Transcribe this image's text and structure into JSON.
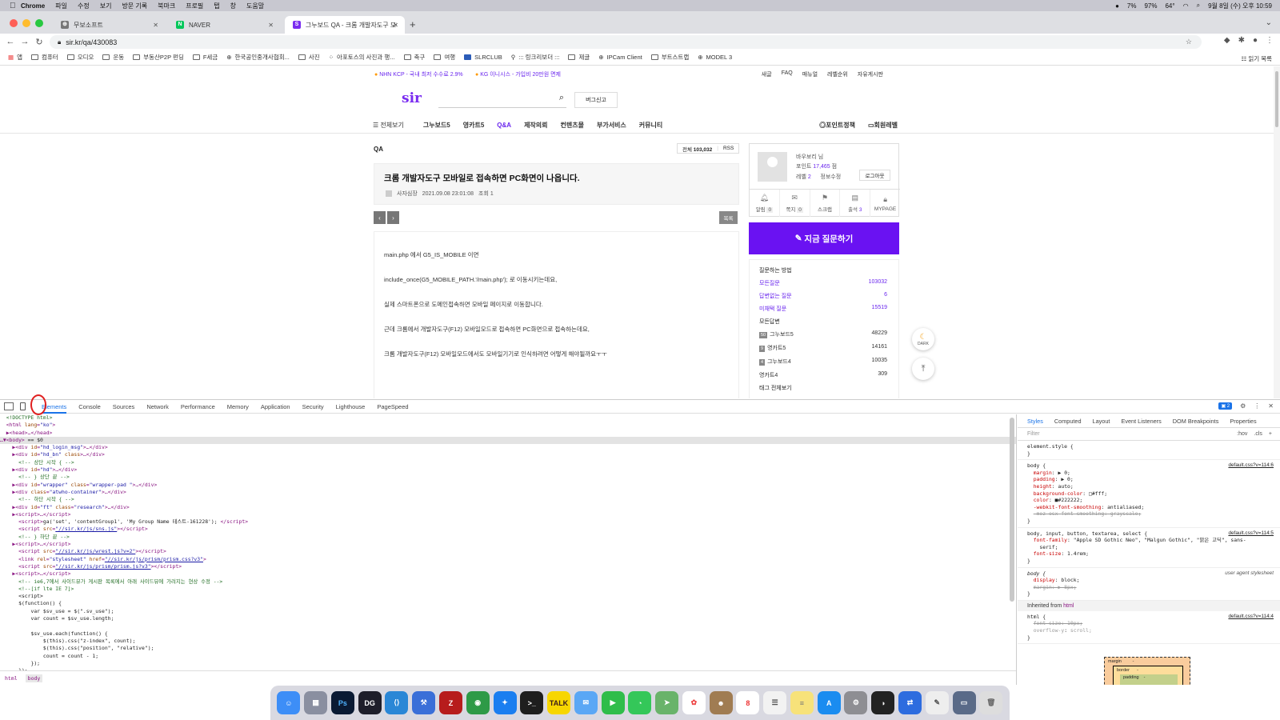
{
  "menubar": {
    "app": "Chrome",
    "items": [
      "파일",
      "수정",
      "보기",
      "방문 기록",
      "북마크",
      "프로필",
      "탭",
      "창",
      "도움말"
    ],
    "status": [
      "7%",
      "97%",
      "64°"
    ],
    "clock": "9월 8일 (수) 오후 10:59"
  },
  "tabs": [
    {
      "title": "무보소프트",
      "icon": "globe-icon",
      "color": "#555555"
    },
    {
      "title": "NAVER",
      "icon": "naver-icon",
      "color": "#03c75a"
    },
    {
      "title": "그누보드 QA - 크롬 개발자도구 모바",
      "icon": "sir-icon",
      "color": "#7a2cf0"
    }
  ],
  "address": {
    "url": "sir.kr/qa/430083"
  },
  "bookmarks": [
    "앱",
    "컴퓨터",
    "오디오",
    "운동",
    "부동산P2P 펀딩",
    "F세금",
    "한국공인중개사협회...",
    "사진",
    "아포토스의 사진과 행...",
    "축구",
    "여행",
    "SLRCLUB",
    "::: 링크리보더 :::",
    "제글",
    "IPCam Client",
    "부트스트랩",
    "MODEL 3"
  ],
  "bookmarks_right": "읽기 목록",
  "site": {
    "notice1": "NHN KCP - 국내 최저 수수료 2.9%",
    "notice2": "KG 이니시스 - 가입비 20만원 면제",
    "toplinks": [
      "새글",
      "FAQ",
      "매뉴얼",
      "레벨순위",
      "자유게시판"
    ],
    "logo": "sir",
    "bug_button": "버그신고",
    "nav_all": "전체보기",
    "nav": [
      "그누보드5",
      "영카트5",
      "Q&A",
      "제작의뢰",
      "컨텐츠몰",
      "부가서비스",
      "커뮤니티"
    ],
    "nav_right": [
      "포인트정책",
      "회원레벨"
    ]
  },
  "post": {
    "board": "QA",
    "total_label": "전체",
    "total": "103,032",
    "rss": "RSS",
    "title": "크롬 개발자도구 모바일로 접속하면 PC화면이 나옵니다.",
    "author": "사자심장",
    "date": "2021.09.08 23:01:08",
    "views": "조회 1",
    "list_button": "목록",
    "lines": [
      "main.php 에서 G5_IS_MOBILE 이면",
      "include_once(G5_MOBILE_PATH.'/main.php'); 로 이동시키는데요,",
      "실제 스마트폰으로 도메인접속하면 모바일 페이지로 이동합니다.",
      "근데 크롬에서 개발자도구(F12) 모바일모드로 접속하면 PC화면으로 접속하는데요,",
      "크롬 개발자도구(F12) 모바일모드에서도 모바일기기로 인식하려면 어떻게 해야될까요ㅜㅜ"
    ]
  },
  "sidebar": {
    "name": "바우보리 님",
    "point_label": "포인트",
    "point": "17,465",
    "point_unit": "점",
    "level_label": "레벨",
    "level": "2",
    "edit": "정보수정",
    "logout": "로그아웃",
    "icons": [
      {
        "label": "알림",
        "count": "0",
        "icon": "bell-icon"
      },
      {
        "label": "쪽지",
        "count": "0",
        "icon": "mail-icon"
      },
      {
        "label": "스크랩",
        "count": "",
        "icon": "bookmark-icon"
      },
      {
        "label": "출석",
        "count": "3",
        "icon": "attendance-icon"
      },
      {
        "label": "MYPAGE",
        "count": "",
        "icon": "lock-icon"
      }
    ],
    "ask_button": "지금 질문하기",
    "how_to": "질문하는 방법",
    "q_stats": [
      {
        "label": "모든질문",
        "value": "103032"
      },
      {
        "label": "답변없는 질문",
        "value": "6"
      },
      {
        "label": "미채택 질문",
        "value": "15519"
      }
    ],
    "answers_head": "모든답변",
    "a_stats": [
      {
        "badge": "50",
        "label": "그누보드5",
        "value": "48229"
      },
      {
        "badge": "9",
        "label": "영카트5",
        "value": "14161"
      },
      {
        "badge": "4",
        "label": "그누보드4",
        "value": "10035"
      },
      {
        "badge": "",
        "label": "영카트4",
        "value": "309"
      }
    ],
    "tags": "태그 전체보기"
  },
  "float": {
    "dark": "DARK"
  },
  "devtools": {
    "tabs": [
      "Elements",
      "Console",
      "Sources",
      "Network",
      "Performance",
      "Memory",
      "Application",
      "Security",
      "Lighthouse",
      "PageSpeed"
    ],
    "issues": "2",
    "breadcrumbs": [
      "html",
      "body"
    ],
    "styles_tabs": [
      "Styles",
      "Computed",
      "Layout",
      "Event Listeners",
      "DOM Breakpoints",
      "Properties"
    ],
    "filter_placeholder": "Filter",
    "filter_tools": [
      ":hov",
      ".cls",
      "+"
    ],
    "inherited": "Inherited from",
    "inherited_tag": "html"
  }
}
